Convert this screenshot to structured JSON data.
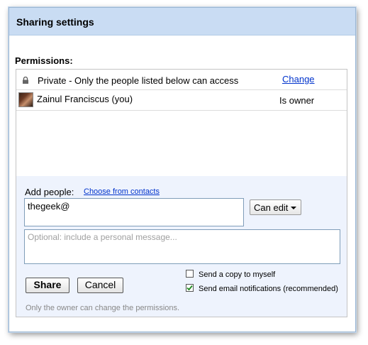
{
  "dialog": {
    "title": "Sharing settings",
    "permissions_label": "Permissions:"
  },
  "permissions": {
    "visibility": {
      "icon": "lock-icon",
      "text": "Private - Only the people listed below can access",
      "change_link": "Change"
    },
    "people": [
      {
        "name": "Zainul Franciscus (you)",
        "role": "Is owner"
      }
    ]
  },
  "add_people": {
    "label": "Add people:",
    "choose_link": "Choose from contacts",
    "input_value": "thegeek@",
    "permission_dropdown": "Can edit",
    "message_placeholder": "Optional: include a personal message..."
  },
  "options": {
    "send_copy": {
      "label": "Send a copy to myself",
      "checked": false
    },
    "send_notifications": {
      "label": "Send email notifications (recommended)",
      "checked": true
    }
  },
  "buttons": {
    "share": "Share",
    "cancel": "Cancel"
  },
  "footer_note": "Only the owner can change the permissions.",
  "colors": {
    "titlebar": "#c9dcf3",
    "add_area": "#eef3fd",
    "link": "#0033cc"
  }
}
